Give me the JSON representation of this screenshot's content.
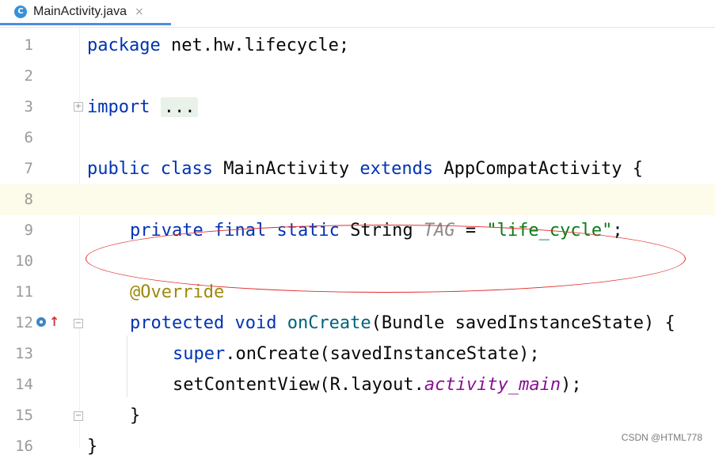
{
  "tab": {
    "icon": "C",
    "label": "MainActivity.java",
    "close": "×"
  },
  "lines": [
    {
      "num": "1"
    },
    {
      "num": "2"
    },
    {
      "num": "3",
      "import_kw": "import",
      "import_fold": "..."
    },
    {
      "num": "6"
    },
    {
      "num": "7"
    },
    {
      "num": "8"
    },
    {
      "num": "9"
    },
    {
      "num": "10"
    },
    {
      "num": "11"
    },
    {
      "num": "12"
    },
    {
      "num": "13"
    },
    {
      "num": "14"
    },
    {
      "num": "15"
    },
    {
      "num": "16"
    }
  ],
  "code": {
    "l1": {
      "kw": "package",
      "rest": " net.hw.lifecycle;"
    },
    "l7": {
      "kw1": "public",
      "kw2": "class",
      "name": " MainActivity ",
      "kw3": "extends",
      "rest": " AppCompatActivity {"
    },
    "l9": {
      "kw1": "private",
      "kw2": "final",
      "kw3": "static",
      "type": " String ",
      "const": "TAG",
      "eq": " = ",
      "str": "\"life_cycle\"",
      "end": ";"
    },
    "l11": {
      "ann": "@Override"
    },
    "l12": {
      "kw1": "protected",
      "kw2": "void",
      "fn": "onCreate",
      "rest": "(Bundle savedInstanceState) {"
    },
    "l13": {
      "kw": "super",
      "rest": ".onCreate(savedInstanceState);"
    },
    "l14": {
      "pre": "setContentView(R.layout.",
      "it": "activity_main",
      "end": ");"
    },
    "l15": {
      "brace": "}"
    },
    "l16": {
      "brace": "}"
    }
  },
  "watermark": "CSDN @HTML778",
  "colors": {
    "keyword": "#0033b3",
    "string": "#067d17",
    "annotation": "#9e880d",
    "highlight_ellipse": "#e12b2b",
    "current_line": "#fdfbe9"
  },
  "icons": {
    "override": "override-icon",
    "arrow": "implements-up-arrow-icon"
  }
}
